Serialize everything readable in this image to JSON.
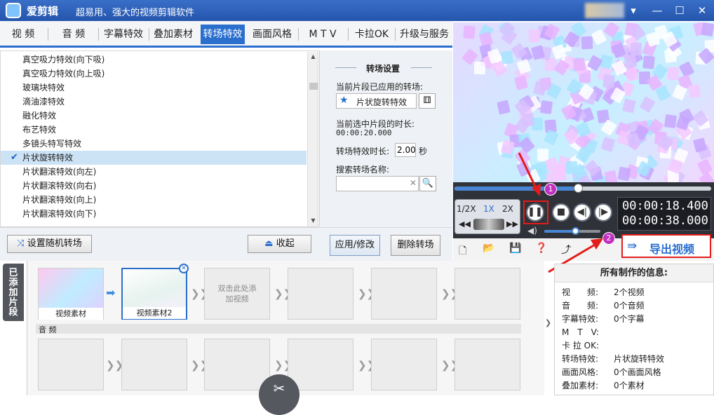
{
  "app": {
    "title": "爱剪辑",
    "slogan": "超易用、强大的视频剪辑软件"
  },
  "tabs": [
    {
      "label": "视 频",
      "active": false
    },
    {
      "label": "音 频",
      "active": false
    },
    {
      "label": "字幕特效",
      "active": false
    },
    {
      "label": "叠加素材",
      "active": false
    },
    {
      "label": "转场特效",
      "active": true
    },
    {
      "label": "画面风格",
      "active": false
    },
    {
      "label": "M T V",
      "active": false
    },
    {
      "label": "卡拉OK",
      "active": false
    },
    {
      "label": "升级与服务",
      "active": false
    }
  ],
  "effects": [
    {
      "label": "真空吸力特效(向下吸)",
      "selected": false
    },
    {
      "label": "真空吸力特效(向上吸)",
      "selected": false
    },
    {
      "label": "玻璃块特效",
      "selected": false
    },
    {
      "label": "滴油漆特效",
      "selected": false
    },
    {
      "label": "融化特效",
      "selected": false
    },
    {
      "label": "布艺特效",
      "selected": false
    },
    {
      "label": "多镜头特写特效",
      "selected": false
    },
    {
      "label": "片状旋转特效",
      "selected": true
    },
    {
      "label": "片状翻滚特效(向左)",
      "selected": false
    },
    {
      "label": "片状翻滚特效(向右)",
      "selected": false
    },
    {
      "label": "片状翻滚特效(向上)",
      "selected": false
    },
    {
      "label": "片状翻滚特效(向下)",
      "selected": false
    }
  ],
  "settings": {
    "heading": "转场设置",
    "applied_label": "当前片段已应用的转场:",
    "applied_value": "片状旋转特效",
    "duration_label": "当前选中片段的时长:",
    "duration_value": "00:00:20.000",
    "effect_duration_label": "转场特效时长:",
    "effect_duration_value": "2.00",
    "effect_duration_unit": "秒",
    "search_label": "搜索转场名称:",
    "search_value": "",
    "apply_button": "应用/修改",
    "delete_button": "删除转场"
  },
  "controls": {
    "random_button": "设置随机转场",
    "collapse_button": "收起"
  },
  "player": {
    "speeds": [
      "1/2X",
      "1X",
      "2X"
    ],
    "active_speed": "1X",
    "current_time": "00:00:18.400",
    "total_time": "00:00:38.000",
    "progress": 0.48,
    "volume": 0.55,
    "export_button": "导出视频"
  },
  "clips": {
    "tab_label": "已添加片段",
    "items": [
      {
        "label": "视频素材"
      },
      {
        "label": "视频素材2"
      }
    ],
    "empty_hint": "双击此处添加视频",
    "audio_label": "音 频"
  },
  "info": {
    "heading": "所有制作的信息:",
    "rows": [
      {
        "key": "视　　频:",
        "value": "2个视频"
      },
      {
        "key": "音　　频:",
        "value": "0个音频"
      },
      {
        "key": "字幕特效:",
        "value": "0个字幕"
      },
      {
        "key": "M　T　V:",
        "value": ""
      },
      {
        "key": "卡 拉 OK:",
        "value": ""
      },
      {
        "key": "转场特效:",
        "value": "片状旋转特效"
      },
      {
        "key": "画面风格:",
        "value": "0个画面风格"
      },
      {
        "key": "叠加素材:",
        "value": "0个素材"
      }
    ]
  },
  "annotations": {
    "badge1": "1",
    "badge2": "2"
  },
  "colors": {
    "accent": "#2b6fce",
    "highlight": "#e41b1b",
    "badge": "#c12fbf"
  }
}
